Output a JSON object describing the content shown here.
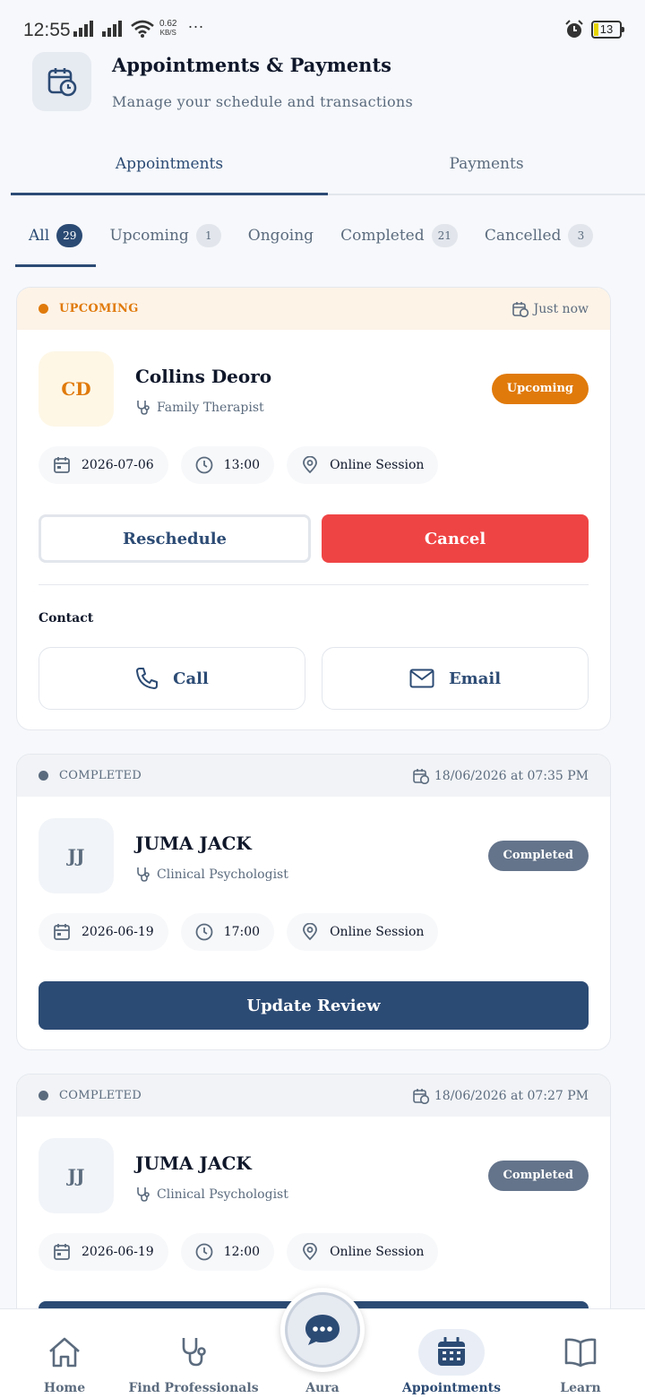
{
  "status_bar": {
    "time": "12:55",
    "net_speed_value": "0.62",
    "net_speed_unit": "KB/S",
    "more": "···",
    "battery": "13"
  },
  "header": {
    "title": "Appointments & Payments",
    "subtitle": "Manage your schedule and transactions",
    "icon": "calendar-clock-icon"
  },
  "main_tabs": [
    {
      "label": "Appointments",
      "active": true
    },
    {
      "label": "Payments",
      "active": false
    }
  ],
  "filter_tabs": [
    {
      "label": "All",
      "count": "29",
      "active": true
    },
    {
      "label": "Upcoming",
      "count": "1",
      "active": false
    },
    {
      "label": "Ongoing",
      "count": "",
      "active": false
    },
    {
      "label": "Completed",
      "count": "21",
      "active": false
    },
    {
      "label": "Cancelled",
      "count": "3",
      "active": false
    }
  ],
  "appointments": [
    {
      "banner_status": "UPCOMING",
      "banner_time": "Just now",
      "initials": "CD",
      "name": "Collins Deoro",
      "role": "Family Therapist",
      "status_pill": "Upcoming",
      "date": "2026-07-06",
      "time": "13:00",
      "location": "Online Session",
      "actions": {
        "reschedule": "Reschedule",
        "cancel": "Cancel"
      },
      "contact": {
        "label": "Contact",
        "call": "Call",
        "email": "Email"
      }
    },
    {
      "banner_status": "COMPLETED",
      "banner_time": "18/06/2026 at 07:35 PM",
      "initials": "JJ",
      "name": "JUMA JACK",
      "role": "Clinical Psychologist",
      "status_pill": "Completed",
      "date": "2026-06-19",
      "time": "17:00",
      "location": "Online Session",
      "action": "Update Review"
    },
    {
      "banner_status": "COMPLETED",
      "banner_time": "18/06/2026 at 07:27 PM",
      "initials": "JJ",
      "name": "JUMA JACK",
      "role": "Clinical Psychologist",
      "status_pill": "Completed",
      "date": "2026-06-19",
      "time": "12:00",
      "location": "Online Session"
    }
  ],
  "bottom_nav": [
    {
      "label": "Home",
      "icon": "home-icon",
      "active": false
    },
    {
      "label": "Find Professionals",
      "icon": "stethoscope-icon",
      "active": false
    },
    {
      "label": "Aura",
      "icon": "chat-bubble-icon",
      "active": false
    },
    {
      "label": "Appointments",
      "icon": "calendar-icon",
      "active": true
    },
    {
      "label": "Learn",
      "icon": "book-icon",
      "active": false
    }
  ],
  "colors": {
    "navy": "#2c4b74",
    "orange": "#e07a0b",
    "red": "#ef4444",
    "gray_pill": "#64748b",
    "upcoming_banner": "#fdf3e7",
    "completed_banner": "#f1f3f6"
  }
}
